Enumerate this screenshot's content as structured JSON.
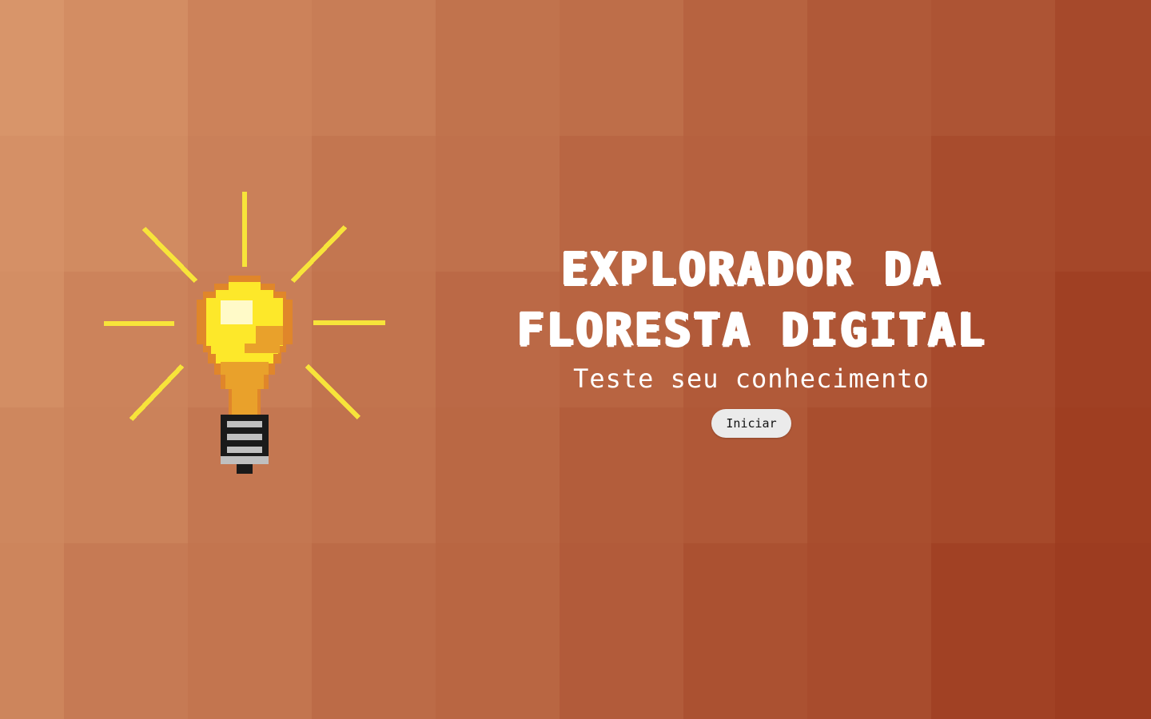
{
  "hero": {
    "title_line1": "EXPLORADOR DA",
    "title_line2": "FLORESTA DIGITAL",
    "subtitle": "Teste seu conhecimento",
    "start_label": "Iniciar",
    "illustration_icon": "lightbulb-icon"
  },
  "colors": {
    "background_light": "#d8956a",
    "background_dark": "#9c3a1e",
    "text": "#ffffff",
    "button_bg": "#ebebeb",
    "bulb_glass": "#fde82a",
    "bulb_shade": "#e9a12b",
    "bulb_outline": "#e0862a",
    "rays": "#f7e43a",
    "socket_dark": "#1a1a1a",
    "socket_light": "#bfbfbf"
  }
}
